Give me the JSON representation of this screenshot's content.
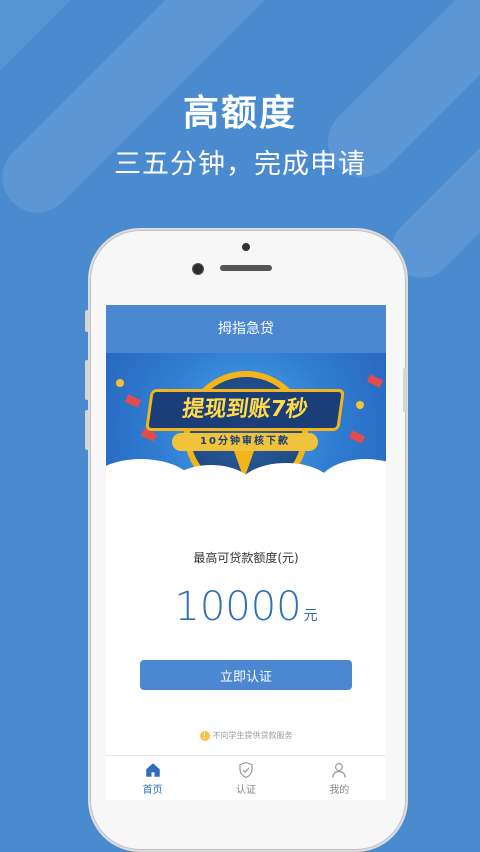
{
  "hero": {
    "title": "高额度",
    "subtitle": "三五分钟，完成申请"
  },
  "app": {
    "header_title": "拇指急贷",
    "banner": {
      "title": "提现到账7秒",
      "subtitle": "10分钟审核下款"
    },
    "limit": {
      "label": "最高可贷款额度(元)",
      "value": "10000",
      "unit": "元"
    },
    "verify_button": "立即认证",
    "notice": "不向学生提供贷款服务"
  },
  "tabs": [
    {
      "label": "首页",
      "icon": "home-icon",
      "active": true
    },
    {
      "label": "认证",
      "icon": "shield-check-icon",
      "active": false
    },
    {
      "label": "我的",
      "icon": "user-icon",
      "active": false
    }
  ],
  "colors": {
    "background": "#4a8bd0",
    "brand_blue": "#4b88d1",
    "value_blue": "#2f6fba",
    "badge_gold": "#f3b51a"
  }
}
